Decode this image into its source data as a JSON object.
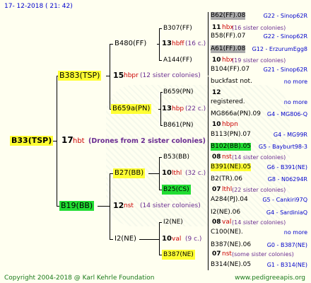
{
  "header": {
    "timestamp": "17- 12-2018 ( 21: 42)"
  },
  "root": {
    "name": "B33(TSP)",
    "num": "17",
    "hbt": "hbt",
    "drones": "(Drones from 2 sister colonies)"
  },
  "gen1": {
    "top": {
      "name": "B383(TSP)",
      "num": "15",
      "tag": "hbpr",
      "sis": "(12 sister colonies)"
    },
    "bottom": {
      "name": "B19(BB)",
      "num": "12",
      "tag": "nst",
      "sis": "(14 sister colonies)"
    }
  },
  "gen2": {
    "a": {
      "name": "B480(FF)",
      "num": "13",
      "tag": "hbff",
      "sis": "(16 c.)"
    },
    "b": {
      "name": "B659a(PN)",
      "num": "13",
      "tag": "hbp",
      "sis": "(22 c.)"
    },
    "c": {
      "name": "B27(BB)",
      "num": "10",
      "tag": "lthl",
      "sis": "(32 c.)"
    },
    "d": {
      "name": "I2(NE)",
      "num": "10",
      "tag": "val",
      "sis": "(9 c.)"
    }
  },
  "gen3": {
    "a": {
      "name": "B307(FF)",
      "num": "11",
      "tag": "hbx",
      "sis": "(16 sister colonies)"
    },
    "b": {
      "name": "A144(FF)",
      "num": "10",
      "tag": "hbx",
      "sis": "(19 sister colonies)"
    },
    "c": {
      "name": "B659(PN)",
      "num": "12",
      "tag": "",
      "sis": ""
    },
    "d": {
      "name": "B861(PN)",
      "num": "10",
      "tag": "hbpn",
      "sis": ""
    },
    "e": {
      "name": "B53(BB)",
      "num": "08",
      "tag": "nst",
      "sis": "(14 sister colonies)"
    },
    "f": {
      "name": "B25(CS)",
      "num": "07",
      "tag": "lthl",
      "sis": "(22 sister colonies)"
    },
    "g": {
      "name": "I2(NE)",
      "num": "08",
      "tag": "val",
      "sis": "(14 sister colonies)"
    },
    "h": {
      "name": "B387(NE)",
      "num": "07",
      "tag": "nst",
      "sis": "(some sister colonies)"
    }
  },
  "gen4": {
    "r1": {
      "left": "B62(FF).08",
      "right": "G22 - Sinop62R"
    },
    "r2": {
      "left": "B58(FF).07",
      "right": "G22 - Sinop62R"
    },
    "r3": {
      "left": "A61(FF).08",
      "right": "G12 - ErzurumEgg8"
    },
    "r4": {
      "left": "B104(FF).07",
      "right": "G21 - Sinop62R"
    },
    "r5": {
      "left": "buckfast not.",
      "right": "no more"
    },
    "r6": {
      "left": "registered.",
      "right": "no more"
    },
    "r7": {
      "left": "MG866a(PN).09",
      "right": "G4 - MG806-Q"
    },
    "r8": {
      "left": "B113(PN).07",
      "right": "G4 - MG99R"
    },
    "r9": {
      "left": "B102(BB).05",
      "right": "G5 - Bayburt98-3"
    },
    "r10": {
      "left": "B391(NE).05",
      "right": "G6 - B391(NE)"
    },
    "r11": {
      "left": "B2(TR).06",
      "right": "G8 - N06294R"
    },
    "r12": {
      "left": "A284(PJ).04",
      "right": "G5 - Cankiri97Q"
    },
    "r13": {
      "left": "I2(NE).06",
      "right": "G4 - SardiniaQ"
    },
    "r14": {
      "left": "C100(NE).",
      "right": "no more"
    },
    "r15": {
      "left": "B387(NE).06",
      "right": "G0 - B387(NE)"
    },
    "r16": {
      "left": "B314(NE).05",
      "right": "G1 - B314(NE)"
    }
  },
  "footer": {
    "copyright": "Copyright 2004-2018 @ Karl Kehrle Foundation",
    "url": "www.pedigreeapis.org"
  }
}
